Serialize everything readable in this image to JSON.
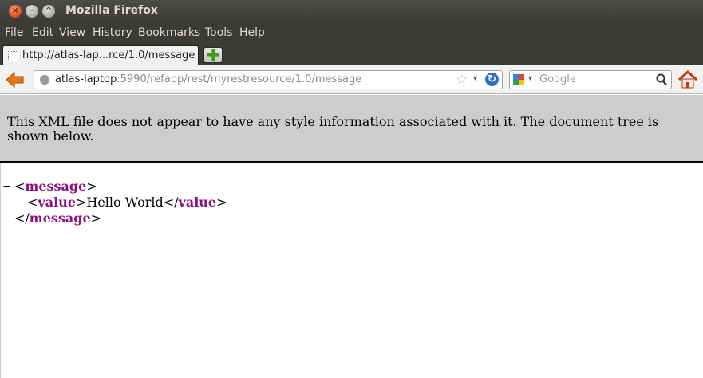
{
  "window": {
    "title": "Mozilla Firefox",
    "buttons": {
      "close": "×",
      "minimize": "−",
      "maximize": "^"
    }
  },
  "menu": {
    "items": [
      {
        "label": "File"
      },
      {
        "label": "Edit"
      },
      {
        "label": "View"
      },
      {
        "label": "History"
      },
      {
        "label": "Bookmarks"
      },
      {
        "label": "Tools"
      },
      {
        "label": "Help"
      }
    ]
  },
  "tabs": {
    "active": {
      "label": "http://atlas-lap...rce/1.0/message",
      "icon": "blank-page-icon"
    },
    "new_tab_glyph": "✚"
  },
  "navbar": {
    "back_icon": "back-arrow-icon",
    "url": {
      "host": "atlas-laptop",
      "rest": ":5990/refapp/rest/myrestresource/1.0/message"
    },
    "star_glyph": "☆",
    "dropdown_glyph": "▾",
    "reload_glyph": "↻",
    "search": {
      "placeholder": "Google",
      "dropdown_glyph": "▾"
    },
    "home_icon": "home-icon"
  },
  "content": {
    "info_message": "This XML file does not appear to have any style information associated with it. The document tree is shown below.",
    "xml": {
      "collapse_glyph": "−",
      "root_tag": "message",
      "child_tag": "value",
      "child_text": "Hello World"
    }
  },
  "colors": {
    "titlebar": "#3c3b37",
    "xml_tag": "#881280",
    "info_bg": "#cdcdcd"
  }
}
